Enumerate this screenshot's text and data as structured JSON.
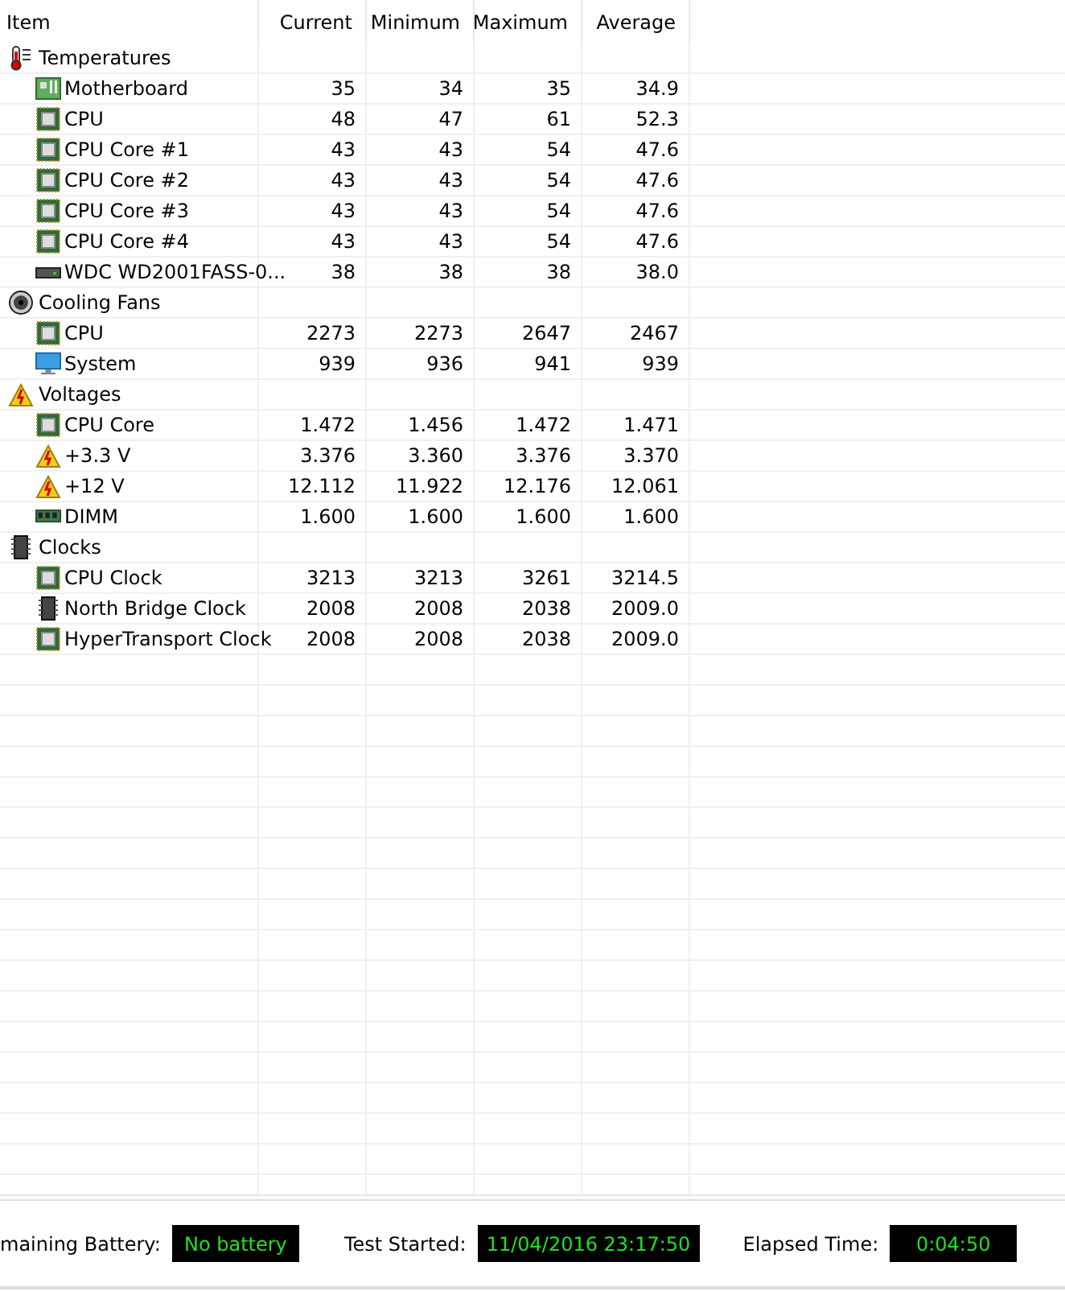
{
  "table": {
    "columns": [
      "Item",
      "Current",
      "Minimum",
      "Maximum",
      "Average"
    ],
    "groups": [
      {
        "name": "Temperatures",
        "kind": "thermometer",
        "children": [
          {
            "name": "Motherboard",
            "kind": "board",
            "values": [
              "35",
              "34",
              "35",
              "34.9"
            ]
          },
          {
            "name": "CPU",
            "kind": "cpu",
            "values": [
              "48",
              "47",
              "61",
              "52.3"
            ]
          },
          {
            "name": "CPU Core #1",
            "kind": "cpu",
            "values": [
              "43",
              "43",
              "54",
              "47.6"
            ]
          },
          {
            "name": "CPU Core #2",
            "kind": "cpu",
            "values": [
              "43",
              "43",
              "54",
              "47.6"
            ]
          },
          {
            "name": "CPU Core #3",
            "kind": "cpu",
            "values": [
              "43",
              "43",
              "54",
              "47.6"
            ]
          },
          {
            "name": "CPU Core #4",
            "kind": "cpu",
            "values": [
              "43",
              "43",
              "54",
              "47.6"
            ]
          },
          {
            "name": "WDC WD2001FASS-0...",
            "kind": "drive",
            "values": [
              "38",
              "38",
              "38",
              "38.0"
            ]
          }
        ]
      },
      {
        "name": "Cooling Fans",
        "kind": "fan",
        "children": [
          {
            "name": "CPU",
            "kind": "cpu",
            "values": [
              "2273",
              "2273",
              "2647",
              "2467"
            ]
          },
          {
            "name": "System",
            "kind": "monitor",
            "values": [
              "939",
              "936",
              "941",
              "939"
            ]
          }
        ]
      },
      {
        "name": "Voltages",
        "kind": "warning",
        "children": [
          {
            "name": "CPU Core",
            "kind": "cpu",
            "values": [
              "1.472",
              "1.456",
              "1.472",
              "1.471"
            ]
          },
          {
            "name": "+3.3 V",
            "kind": "warning",
            "values": [
              "3.376",
              "3.360",
              "3.376",
              "3.370"
            ]
          },
          {
            "name": "+12 V",
            "kind": "warning",
            "values": [
              "12.112",
              "11.922",
              "12.176",
              "12.061"
            ]
          },
          {
            "name": "DIMM",
            "kind": "memory",
            "values": [
              "1.600",
              "1.600",
              "1.600",
              "1.600"
            ]
          }
        ]
      },
      {
        "name": "Clocks",
        "kind": "chip",
        "children": [
          {
            "name": "CPU Clock",
            "kind": "cpu",
            "values": [
              "3213",
              "3213",
              "3261",
              "3214.5"
            ]
          },
          {
            "name": "North Bridge Clock",
            "kind": "chip",
            "values": [
              "2008",
              "2008",
              "2038",
              "2009.0"
            ]
          },
          {
            "name": "HyperTransport Clock",
            "kind": "cpu",
            "values": [
              "2008",
              "2008",
              "2038",
              "2009.0"
            ]
          }
        ]
      }
    ]
  },
  "status_bar": [
    {
      "label": "maining Battery:",
      "value": "No battery"
    },
    {
      "label": "Test Started:",
      "value": "11/04/2016 23:17:50"
    },
    {
      "label": "Elapsed Time:",
      "value": "0:04:50"
    }
  ]
}
